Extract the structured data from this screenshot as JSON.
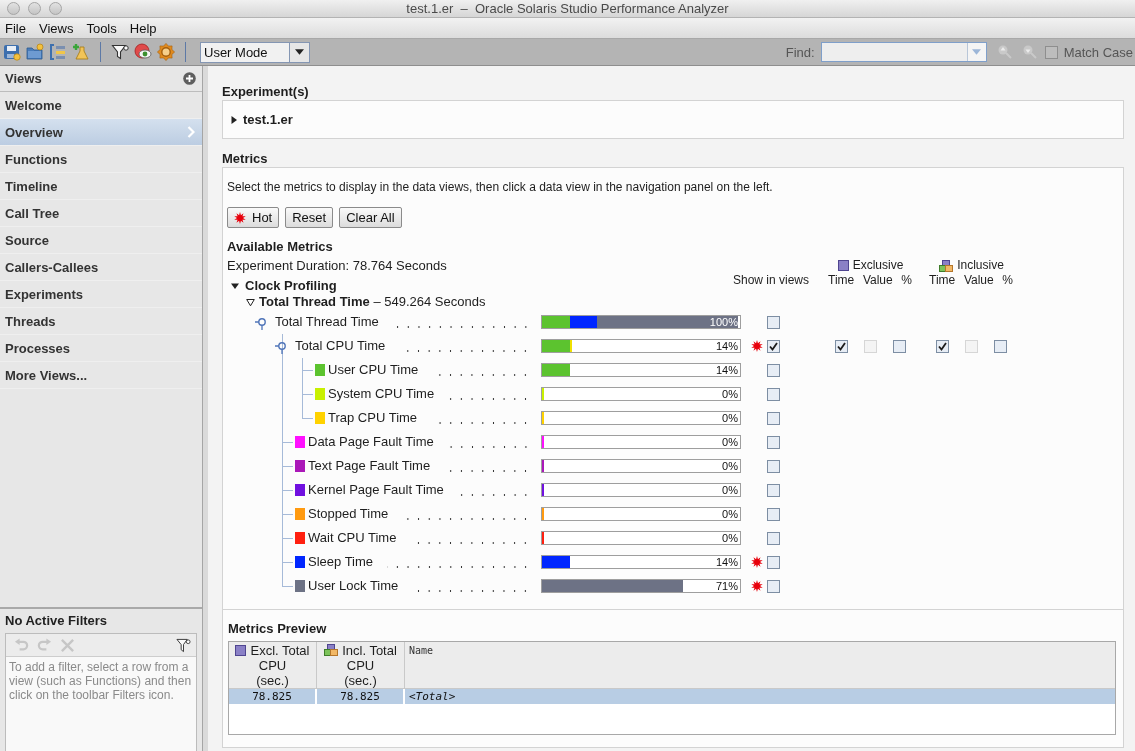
{
  "window": {
    "title": "test.1.er  –  Oracle Solaris Studio Performance Analyzer"
  },
  "menu": [
    {
      "label": "File"
    },
    {
      "label": "Views"
    },
    {
      "label": "Tools"
    },
    {
      "label": "Help"
    }
  ],
  "toolbar": {
    "mode": {
      "value": "User Mode"
    },
    "find": {
      "label": "Find:",
      "disabled": true,
      "match_case": {
        "label": "Match Case",
        "checked": false
      }
    }
  },
  "sidebar": {
    "title": "Views",
    "items": [
      {
        "label": "Welcome",
        "selected": false
      },
      {
        "label": "Overview",
        "selected": true
      },
      {
        "label": "Functions",
        "selected": false
      },
      {
        "label": "Timeline",
        "selected": false
      },
      {
        "label": "Call Tree",
        "selected": false
      },
      {
        "label": "Source",
        "selected": false
      },
      {
        "label": "Callers-Callees",
        "selected": false
      },
      {
        "label": "Experiments",
        "selected": false
      },
      {
        "label": "Threads",
        "selected": false
      },
      {
        "label": "Processes",
        "selected": false
      },
      {
        "label": "More Views...",
        "selected": false
      }
    ]
  },
  "filters": {
    "title": "No Active Filters",
    "disabled": true,
    "hint": "To add a filter, select a row from a view (such as Functions) and then click on the toolbar Filters icon."
  },
  "experiments": {
    "title": "Experiment(s)",
    "items": [
      {
        "label": "test.1.er",
        "expanded": false
      }
    ]
  },
  "metrics": {
    "title": "Metrics",
    "instructions": "Select the metrics to display in the data views, then click a data view in the navigation panel on the left.",
    "buttons": [
      {
        "label": "Hot",
        "kind": "hot"
      },
      {
        "label": "Reset",
        "kind": "plain"
      },
      {
        "label": "Clear All",
        "kind": "plain"
      }
    ],
    "available_title": "Available Metrics",
    "duration": "Experiment Duration: 78.764 Seconds",
    "show_label": "Show in views",
    "column_groups": [
      {
        "label": "Exclusive",
        "kind": "exclusive",
        "columns": [
          "Time",
          "Value",
          "%"
        ]
      },
      {
        "label": "Inclusive",
        "kind": "inclusive",
        "columns": [
          "Time",
          "Value",
          "%"
        ]
      }
    ],
    "groups": [
      {
        "label": "Clock Profiling",
        "expanded": true,
        "sections": [
          {
            "label": "**Total Thread Time** – 549.264 Seconds",
            "expanded": true,
            "rows": [
              {
                "label": "Total Thread Time",
                "segments": [
                  {
                    "color": "#5cc32f",
                    "level": 0.14
                  },
                  {
                    "color": "#0026ff",
                    "level": 0.14
                  },
                  {
                    "color": "#6d7285",
                    "level": 0.71
                  }
                ],
                "reading": "100%",
                "hot": false,
                "checked": false,
                "children": [
                  {
                    "label": "Total CPU Time",
                    "segments": [
                      {
                        "color": "#5cc32f",
                        "level": 0.14
                      },
                      {
                        "color": "#f0e000",
                        "level": 0
                      }
                    ],
                    "reading": "14%",
                    "hot": true,
                    "checked": true,
                    "exclusive": [
                      {
                        "checked": true,
                        "disabled": false
                      },
                      {
                        "checked": false,
                        "disabled": true
                      },
                      {
                        "checked": false,
                        "disabled": false
                      }
                    ],
                    "inclusive": [
                      {
                        "checked": true,
                        "disabled": false
                      },
                      {
                        "checked": false,
                        "disabled": true
                      },
                      {
                        "checked": false,
                        "disabled": false
                      }
                    ],
                    "children": [
                      {
                        "label": "User CPU Time",
                        "color": "#5cc32f",
                        "level": 0.14,
                        "reading": "14%",
                        "hot": false,
                        "checked": false
                      },
                      {
                        "label": "System CPU Time",
                        "color": "#c8f000",
                        "level": 0,
                        "reading": "0%",
                        "hot": false,
                        "checked": false
                      },
                      {
                        "label": "Trap CPU Time",
                        "color": "#ffd200",
                        "level": 0,
                        "reading": "0%",
                        "hot": false,
                        "checked": false
                      }
                    ]
                  },
                  {
                    "label": "Data Page Fault Time",
                    "color": "#ff10ff",
                    "level": 0,
                    "reading": "0%",
                    "hot": false,
                    "checked": false
                  },
                  {
                    "label": "Text Page Fault Time",
                    "color": "#aa18b8",
                    "level": 0,
                    "reading": "0%",
                    "hot": false,
                    "checked": false
                  },
                  {
                    "label": "Kernel Page Fault Time",
                    "color": "#7010e0",
                    "level": 0,
                    "reading": "0%",
                    "hot": false,
                    "checked": false
                  },
                  {
                    "label": "Stopped Time",
                    "color": "#ff9a10",
                    "level": 0,
                    "reading": "0%",
                    "hot": false,
                    "checked": false
                  },
                  {
                    "label": "Wait CPU Time",
                    "color": "#ff2010",
                    "level": 0,
                    "reading": "0%",
                    "hot": false,
                    "checked": false
                  },
                  {
                    "label": "Sleep Time",
                    "color": "#0026ff",
                    "level": 0.14,
                    "reading": "14%",
                    "hot": true,
                    "checked": false
                  },
                  {
                    "label": "User Lock Time",
                    "color": "#6d7285",
                    "level": 0.71,
                    "reading": "71%",
                    "hot": true,
                    "checked": false
                  }
                ]
              }
            ]
          }
        ]
      }
    ]
  },
  "preview": {
    "title": "Metrics Preview",
    "columns": [
      {
        "label": "Excl. Total\nCPU\n(sec.)",
        "kind": "exclusive"
      },
      {
        "label": "Incl. Total\nCPU\n(sec.)",
        "kind": "inclusive"
      },
      {
        "label": "Name",
        "kind": "name"
      }
    ],
    "rows": [
      {
        "selected": true,
        "cells": [
          "78.825",
          "78.825",
          "<Total>"
        ]
      }
    ]
  }
}
